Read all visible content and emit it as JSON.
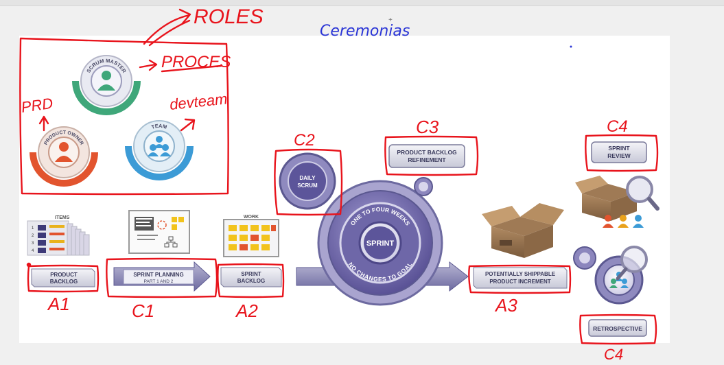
{
  "roles": {
    "scrum_master": "SCRUM MASTER",
    "product_owner": "PRODUCT OWNER",
    "team": "TEAM"
  },
  "artifacts": {
    "items_title": "ITEMS",
    "item_numbers": [
      "1",
      "2",
      "3",
      "4"
    ],
    "work_title": "WORK",
    "product_backlog": [
      "PRODUCT",
      "BACKLOG"
    ],
    "sprint_planning": [
      "SPRINT PLANNING",
      "PART 1 AND 2"
    ],
    "sprint_backlog": [
      "SPRINT",
      "BACKLOG"
    ],
    "daily_scrum": [
      "DAILY",
      "SCRUM"
    ],
    "sprint_center": "SPRINT",
    "sprint_ring_top": "ONE TO FOUR WEEKS",
    "sprint_ring_bottom": "NO CHANGES TO GOAL",
    "backlog_refinement": [
      "PRODUCT BACKLOG",
      "REFINEMENT"
    ],
    "increment": [
      "POTENTIALLY SHIPPABLE",
      "PRODUCT INCREMENT"
    ],
    "sprint_review": [
      "SPRINT",
      "REVIEW"
    ],
    "retrospective": "RETROSPECTIVE"
  },
  "annotations": {
    "roles": "ROLES",
    "proces": "PROCES",
    "ceremonias": "Ceremonias",
    "prd": "PRD",
    "devteam": "devteam",
    "c2": "C2",
    "c3": "C3",
    "c4_top": "C4",
    "c4_bottom": "C4",
    "a1": "A1",
    "c1": "C1",
    "a2": "A2",
    "a3": "A3"
  },
  "colors": {
    "annotation_red": "#e8141c",
    "annotation_blue": "#2a35d6",
    "purple": "#6b62a8",
    "green": "#3fa77a",
    "orange": "#e2542e",
    "teal": "#3c9bd6"
  }
}
